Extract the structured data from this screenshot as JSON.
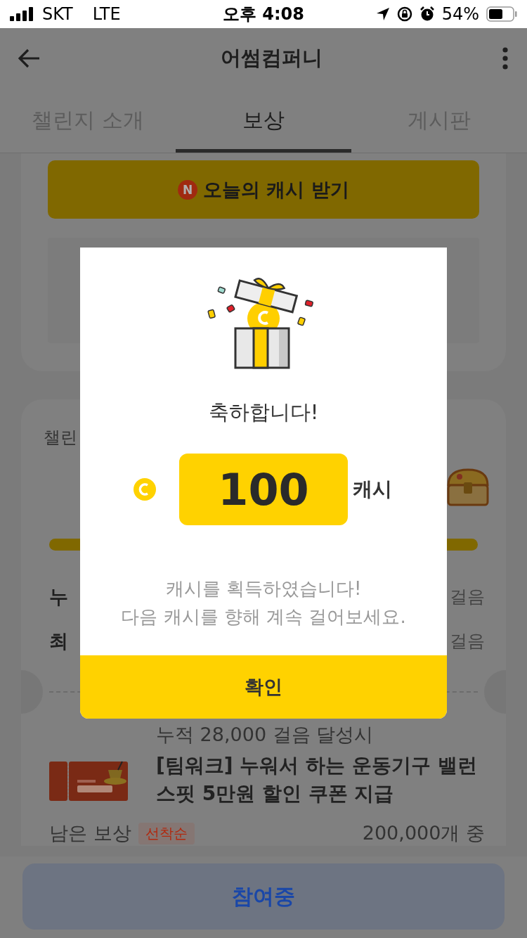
{
  "status_bar": {
    "carrier": "SKT",
    "network": "LTE",
    "time": "오후 4:08",
    "battery": "54%"
  },
  "header": {
    "title": "어썸컴퍼니"
  },
  "tabs": [
    {
      "label": "챌린지 소개",
      "selected": false
    },
    {
      "label": "보상",
      "selected": true
    },
    {
      "label": "게시판",
      "selected": false
    }
  ],
  "daily_cash_button": {
    "badge": "N",
    "label": "오늘의 캐시 받기"
  },
  "challenge_card": {
    "title": "챌린",
    "progress": {
      "level": 1
    },
    "stats": [
      {
        "label": "누",
        "value": "걸음"
      },
      {
        "label": "최",
        "value": "걸음"
      }
    ],
    "reward": {
      "condition": "누적 28,000 걸음 달성시",
      "title": "[팀워크] 누워서 하는 운동기구 밸런스핏 5만원 할인 쿠폰 지급",
      "remaining_label": "남은 보상",
      "tag": "선착순",
      "remaining_value": "200,000개 중"
    }
  },
  "bottom_button": {
    "label": "참여중"
  },
  "modal": {
    "heading": "축하합니다!",
    "amount": "100",
    "unit": "캐시",
    "message": [
      "캐시를 획득하였습니다!",
      "다음 캐시를 향해 계속 걸어보세요."
    ],
    "confirm": "확인"
  }
}
